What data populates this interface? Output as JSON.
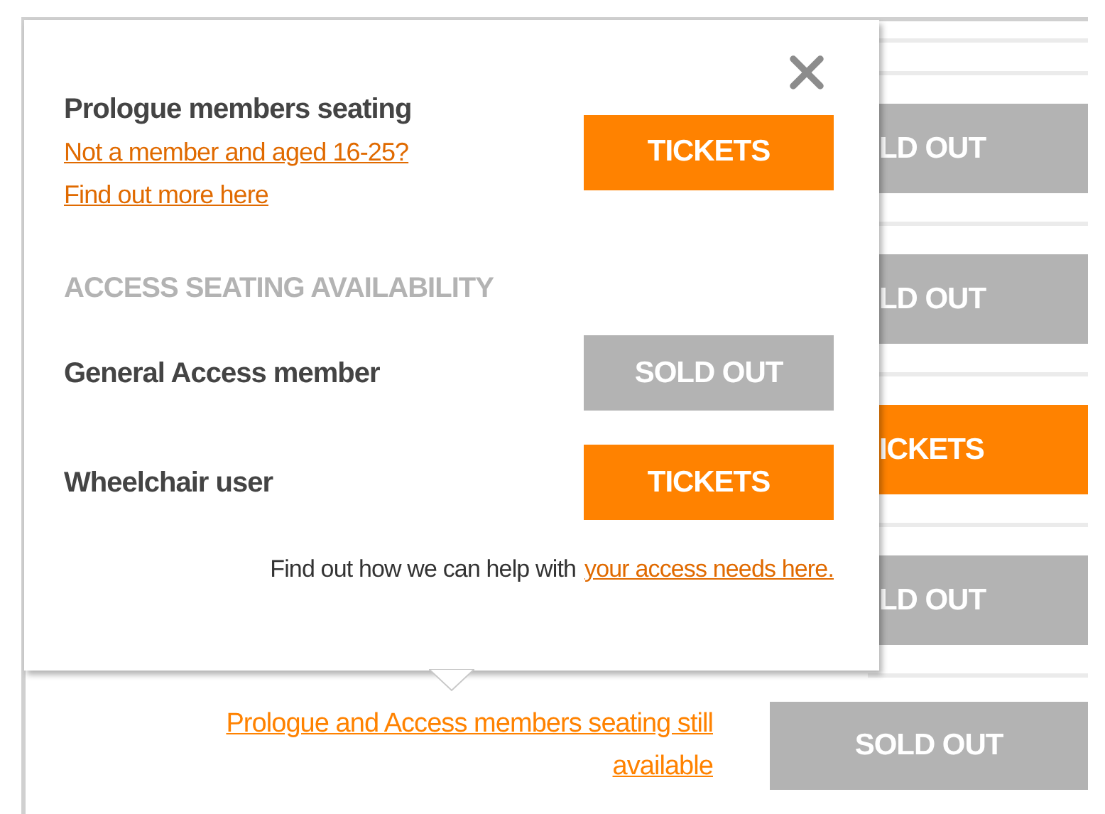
{
  "background_rows": [
    {
      "kind": "sold_out",
      "label": "LD OUT"
    },
    {
      "kind": "sold_out",
      "label": "LD OUT"
    },
    {
      "kind": "tickets",
      "label": "ICKETS"
    },
    {
      "kind": "sold_out",
      "label": "LD OUT"
    }
  ],
  "popup": {
    "prologue": {
      "title": "Prologue members seating",
      "links": [
        "Not a member and aged 16-25?",
        "Find out more here"
      ],
      "button": {
        "kind": "tickets",
        "label": "TICKETS"
      }
    },
    "access_heading": "ACCESS SEATING AVAILABILITY",
    "access_rows": [
      {
        "label": "General Access member",
        "button": {
          "kind": "sold_out",
          "label": "SOLD OUT"
        }
      },
      {
        "label": "Wheelchair user",
        "button": {
          "kind": "tickets",
          "label": "TICKETS"
        }
      }
    ],
    "help_text": "Find out how we can help with",
    "help_link": "your access needs here."
  },
  "footer_row": {
    "link": "Prologue and Access members seating still available",
    "button": {
      "kind": "sold_out",
      "label": "SOLD OUT"
    }
  }
}
